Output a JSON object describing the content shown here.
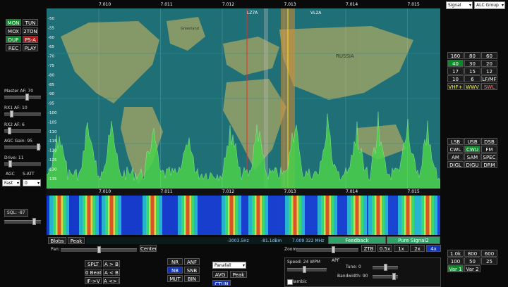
{
  "top_selects": {
    "meter": "Signal",
    "alc": "ALC Group"
  },
  "mode_buttons": [
    {
      "label": "MON",
      "style": "on"
    },
    {
      "label": "TUN",
      "style": ""
    },
    {
      "label": "MOX",
      "style": ""
    },
    {
      "label": "2TON",
      "style": ""
    },
    {
      "label": "DUP",
      "style": "on"
    },
    {
      "label": "PS-A",
      "style": "red"
    },
    {
      "label": "REC",
      "style": ""
    },
    {
      "label": "PLAY",
      "style": ""
    }
  ],
  "left_controls": {
    "master_af": "Master AF: 70",
    "rx1_af": "RX1 AF: 10",
    "rx2_af": "RX2 AF: 6",
    "agc_gain": "AGC Gain: 95",
    "drive": "Drive: 11",
    "agc": "AGC",
    "satt": "S-ATT",
    "agc_mode": "Fast",
    "satt_value": "0",
    "sql": "SQL: -87"
  },
  "freq_ticks_top": [
    "7.010",
    "7.011",
    "7.012",
    "7.013",
    "7.014",
    "7.015"
  ],
  "freq_ticks_mid": [
    "7.010",
    "7.011",
    "7.012",
    "7.013",
    "7.014",
    "7.015"
  ],
  "db_ticks": [
    "-50",
    "-55",
    "-60",
    "-65",
    "-70",
    "-75",
    "-80",
    "-85",
    "-90",
    "-95",
    "-100",
    "-105",
    "-110",
    "-115",
    "-120",
    "-125",
    "-130",
    "-135"
  ],
  "map_labels": {
    "callsign1": "LZ7A",
    "callsign2": "VL2A",
    "greenland": "Greenland",
    "russia": "RUSSIA"
  },
  "band_buttons": [
    {
      "label": "160",
      "style": ""
    },
    {
      "label": "80",
      "style": ""
    },
    {
      "label": "60",
      "style": ""
    },
    {
      "label": "40",
      "style": "on"
    },
    {
      "label": "30",
      "style": ""
    },
    {
      "label": "20",
      "style": ""
    },
    {
      "label": "17",
      "style": ""
    },
    {
      "label": "15",
      "style": ""
    },
    {
      "label": "12",
      "style": ""
    },
    {
      "label": "10",
      "style": ""
    },
    {
      "label": "6",
      "style": ""
    },
    {
      "label": "LF/MF",
      "style": ""
    },
    {
      "label": "VHF+",
      "style": "yel"
    },
    {
      "label": "WWV",
      "style": "yel"
    },
    {
      "label": "SWL",
      "style": "pink"
    }
  ],
  "demod_buttons": [
    {
      "label": "LSB",
      "style": ""
    },
    {
      "label": "USB",
      "style": ""
    },
    {
      "label": "DSB",
      "style": ""
    },
    {
      "label": "CWL",
      "style": ""
    },
    {
      "label": "CWU",
      "style": "on"
    },
    {
      "label": "FM",
      "style": ""
    },
    {
      "label": "AM",
      "style": ""
    },
    {
      "label": "SAM",
      "style": ""
    },
    {
      "label": "SPEC",
      "style": ""
    },
    {
      "label": "DIGL",
      "style": ""
    },
    {
      "label": "DIGU",
      "style": ""
    },
    {
      "label": "DRM",
      "style": ""
    }
  ],
  "blobs_peak": {
    "blobs": "Blobs",
    "peak": "Peak"
  },
  "status_bar": {
    "offset": "-3003.5Hz",
    "level": "-81.1dBm",
    "freq": "7.009 322 MHz",
    "feedback": "Feedback",
    "pure_signal": "Pure Signal2"
  },
  "pan": {
    "label": "Pan:",
    "center": "Center"
  },
  "zoom": {
    "label": "Zoom:",
    "buttons": [
      "ZTB",
      "0.5x",
      "1x",
      "2x",
      "4x"
    ]
  },
  "dsp_buttons": [
    {
      "label": "SPLT",
      "style": ""
    },
    {
      "label": "A > B",
      "style": ""
    },
    {
      "label": "0 Beat",
      "style": ""
    },
    {
      "label": "A < B",
      "style": ""
    },
    {
      "label": "IF->V",
      "style": ""
    },
    {
      "label": "A <> B",
      "style": ""
    }
  ],
  "nr_buttons": [
    {
      "label": "NR",
      "style": ""
    },
    {
      "label": "ANF",
      "style": ""
    },
    {
      "label": "NB",
      "style": "blue"
    },
    {
      "label": "SNB",
      "style": ""
    },
    {
      "label": "MUT",
      "style": ""
    },
    {
      "label": "BIN",
      "style": ""
    }
  ],
  "display_mode": "Panafall",
  "avg_peak": {
    "avg": "AVG",
    "peak": "Peak"
  },
  "ctun": "CTUN",
  "cw": {
    "speed": "Speed: 24 WPM",
    "apf": "APF",
    "tune": "Tune: 0",
    "bandwidth": "Bandwidth: 90",
    "iambic": "Iambic"
  },
  "filter_buttons": [
    {
      "label": "1.0k",
      "style": ""
    },
    {
      "label": "800",
      "style": ""
    },
    {
      "label": "600",
      "style": ""
    },
    {
      "label": "100",
      "style": ""
    },
    {
      "label": "50",
      "style": ""
    },
    {
      "label": "25",
      "style": ""
    },
    {
      "label": "Var 1",
      "style": "on"
    },
    {
      "label": "Var 2",
      "style": ""
    }
  ],
  "colors": {
    "panadapter_bg": "#1f6f77",
    "trace": "#4bd24b",
    "active_green": "#0c8a2a"
  }
}
